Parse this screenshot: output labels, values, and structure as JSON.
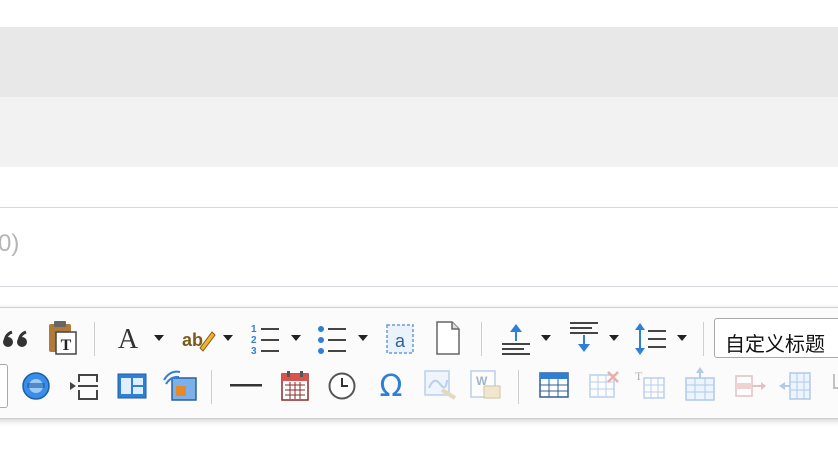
{
  "input": {
    "counter_text": "0)"
  },
  "toolbar": {
    "heading_select_value": "自定义标题",
    "text_color_glyph": "A",
    "highlight_glyph": "ab",
    "special_char_glyph": "Ω",
    "anchor_glyph": "a"
  },
  "colors": {
    "accent_blue": "#2f7fd6",
    "icon_dark": "#3a3a3a",
    "calendar_red": "#d9534f"
  }
}
